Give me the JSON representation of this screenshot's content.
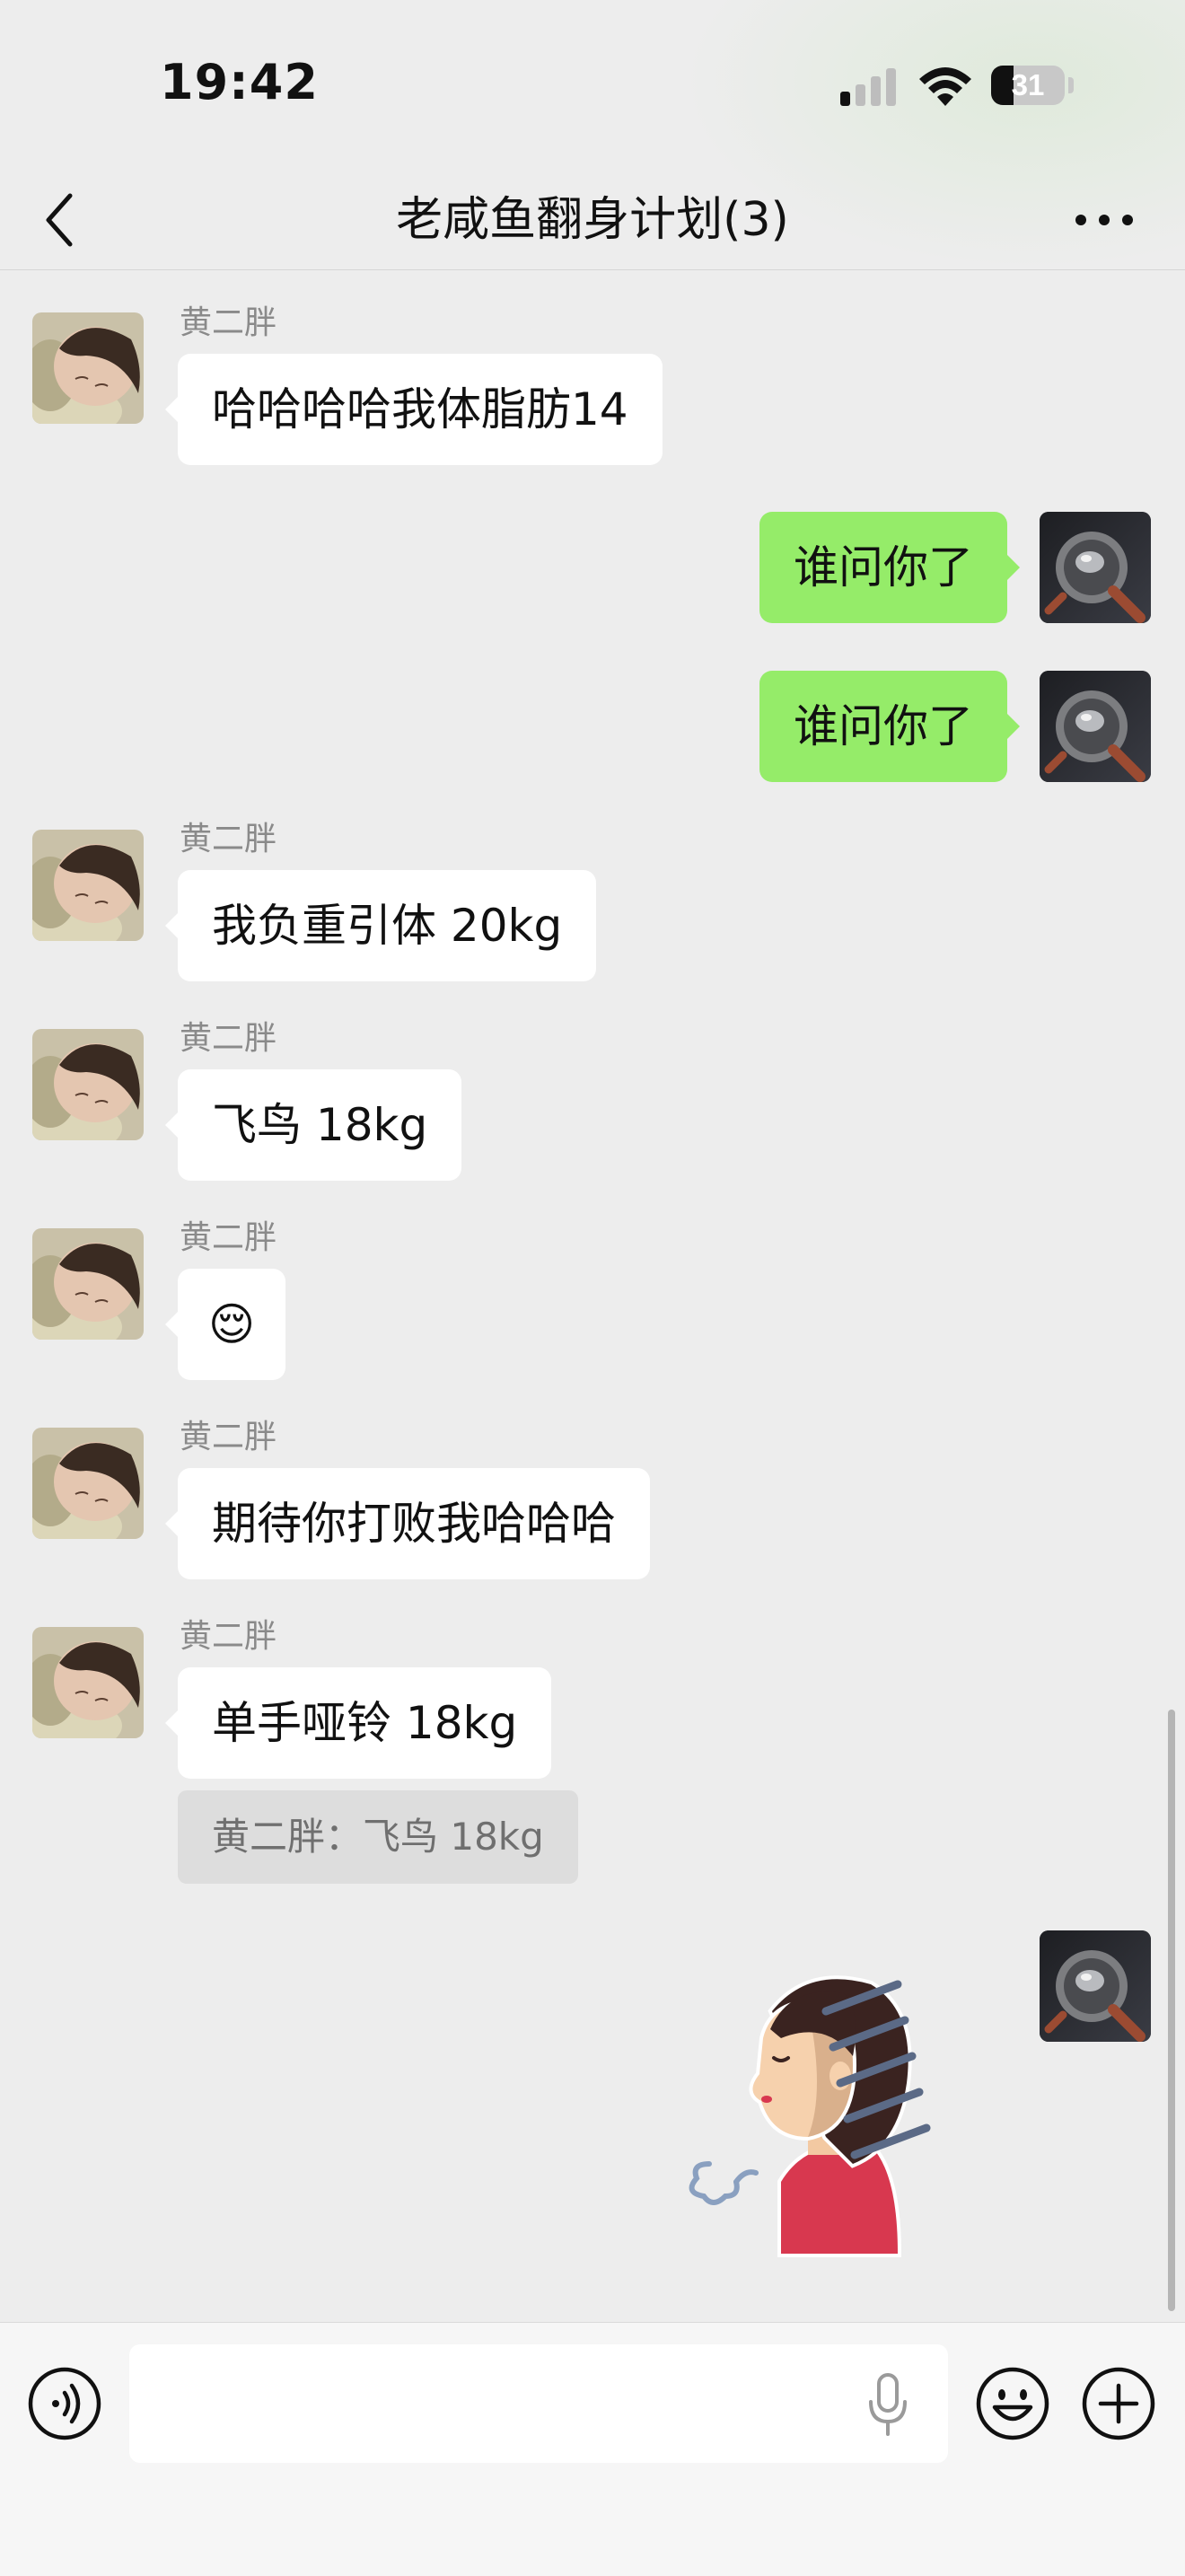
{
  "status_bar": {
    "time": "19:42",
    "battery": "31",
    "battery_level": 0.31
  },
  "nav": {
    "title": "老咸鱼翻身计划(3)"
  },
  "messages": [
    {
      "side": "in",
      "sender": "黄二胖",
      "text": "哈哈哈哈我体脂肪14"
    },
    {
      "side": "out",
      "text": "谁问你了"
    },
    {
      "side": "out",
      "text": "谁问你了"
    },
    {
      "side": "in",
      "sender": "黄二胖",
      "text": "我负重引体 20kg"
    },
    {
      "side": "in",
      "sender": "黄二胖",
      "text": "飞鸟 18kg"
    },
    {
      "side": "in",
      "sender": "黄二胖",
      "text": "😌"
    },
    {
      "side": "in",
      "sender": "黄二胖",
      "text": "期待你打败我哈哈哈"
    },
    {
      "side": "in",
      "sender": "黄二胖",
      "text": "单手哑铃 18kg",
      "quote": "黄二胖：飞鸟 18kg"
    },
    {
      "side": "out",
      "type": "sticker",
      "sticker": "sighing-woman-sticker"
    }
  ],
  "input_bar": {
    "placeholder": "",
    "value": ""
  },
  "icons": {
    "back": "chevron-left-icon",
    "more": "more-dots-icon",
    "voice": "voice-mode-icon",
    "mic": "microphone-icon",
    "emoji": "emoji-icon",
    "plus": "plus-icon"
  },
  "colors": {
    "background": "#ededed",
    "incoming_bubble": "#ffffff",
    "outgoing_bubble": "#95ec69",
    "input_bar": "#f6f6f6"
  }
}
